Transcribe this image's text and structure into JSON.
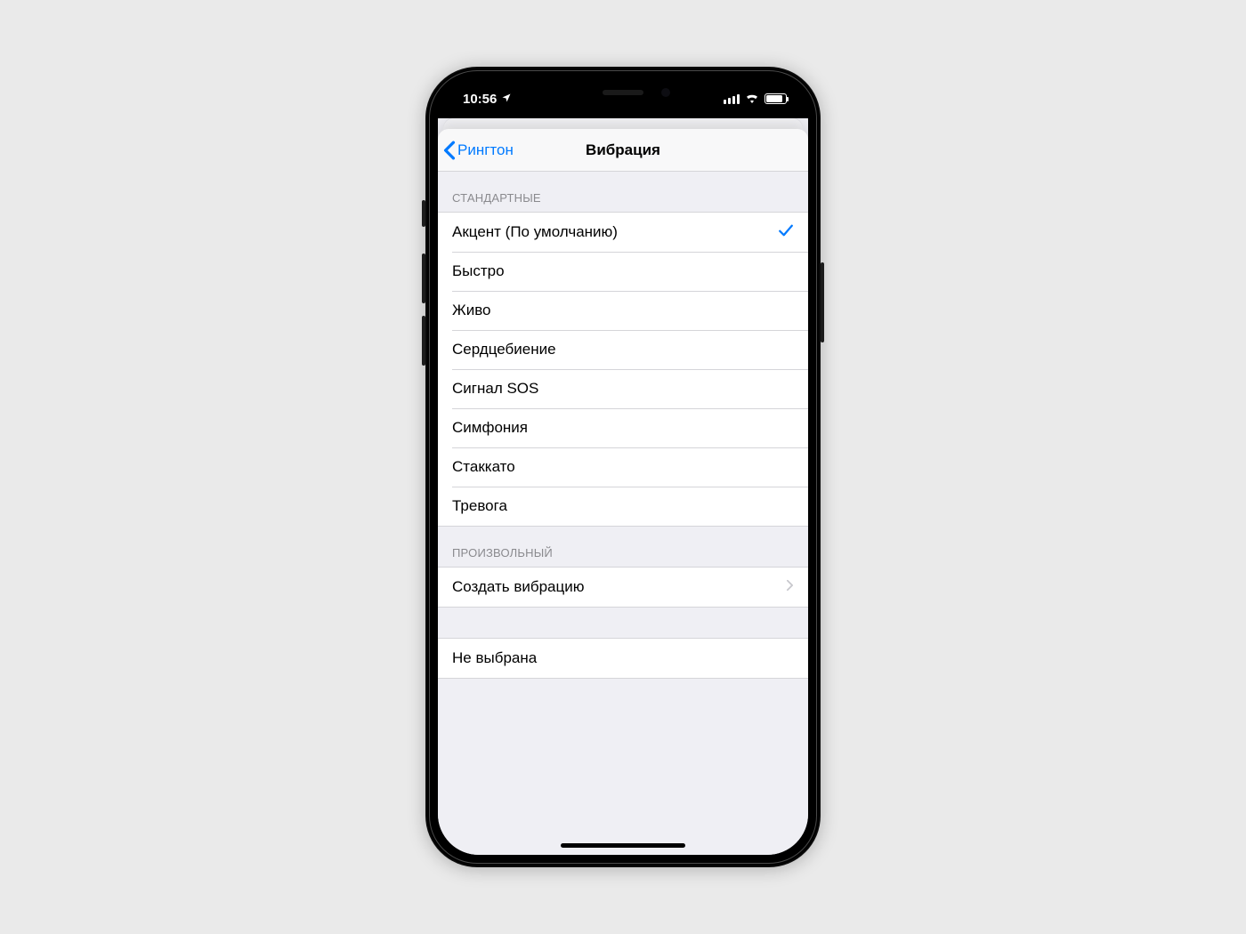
{
  "status_bar": {
    "time": "10:56",
    "location_icon": "location-arrow"
  },
  "navigation": {
    "back_label": "Рингтон",
    "title": "Вибрация"
  },
  "sections": {
    "standard": {
      "header": "СТАНДАРТНЫЕ",
      "items": [
        {
          "label": "Акцент (По умолчанию)",
          "selected": true
        },
        {
          "label": "Быстро",
          "selected": false
        },
        {
          "label": "Живо",
          "selected": false
        },
        {
          "label": "Сердцебиение",
          "selected": false
        },
        {
          "label": "Сигнал SOS",
          "selected": false
        },
        {
          "label": "Симфония",
          "selected": false
        },
        {
          "label": "Стаккато",
          "selected": false
        },
        {
          "label": "Тревога",
          "selected": false
        }
      ]
    },
    "custom": {
      "header": "ПРОИЗВОЛЬНЫЙ",
      "create_label": "Создать вибрацию"
    },
    "none": {
      "label": "Не выбрана"
    }
  }
}
